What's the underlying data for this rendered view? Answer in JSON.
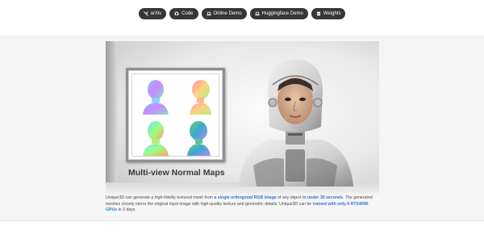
{
  "nav": {
    "buttons": [
      {
        "label": "arXiv",
        "icon": "arxiv-icon"
      },
      {
        "label": "Code",
        "icon": "github-icon"
      },
      {
        "label": "Online Demo",
        "icon": "laptop-icon"
      },
      {
        "label": "Huggingface Demo",
        "icon": "laptop-icon"
      },
      {
        "label": "Weights",
        "icon": "database-icon"
      }
    ]
  },
  "teaser": {
    "caption": "Multi-view Normal Maps"
  },
  "description": {
    "t1": "Unique3D can generate a high-fidelity textured mesh from ",
    "h1": "a single orthogonal RGB image",
    "t2": " of any object ",
    "h2": "in under 30 seconds",
    "t3": ". The generated meshes closely mirror the original input image with high-quality texture and geometric details. Unique3D can be ",
    "h3": "trained with only 8 RTX4090 GPUs",
    "t4": " in 3 days."
  },
  "colors": {
    "pill_bg": "#363636",
    "link": "#3273dc",
    "section_bg": "#f5f5f5"
  }
}
